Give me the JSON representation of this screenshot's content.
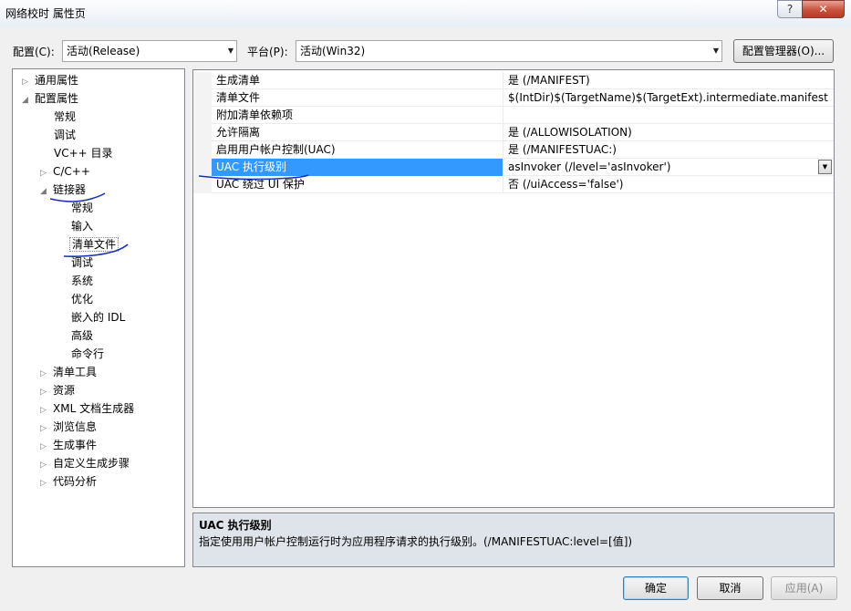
{
  "window": {
    "title": "网络校时 属性页",
    "help_label": "?",
    "close_label": "✕"
  },
  "config_bar": {
    "config_label": "配置(C):",
    "config_value": "活动(Release)",
    "platform_label": "平台(P):",
    "platform_value": "活动(Win32)",
    "manager_label": "配置管理器(O)..."
  },
  "tree": {
    "items": [
      {
        "label": "通用属性",
        "expander": "▷"
      },
      {
        "label": "配置属性",
        "expander": "◢"
      },
      {
        "label": "常规",
        "expander": ""
      },
      {
        "label": "调试",
        "expander": ""
      },
      {
        "label": "VC++ 目录",
        "expander": ""
      },
      {
        "label": "C/C++",
        "expander": "▷"
      },
      {
        "label": "链接器",
        "expander": "◢"
      },
      {
        "label": "常规",
        "expander": ""
      },
      {
        "label": "输入",
        "expander": ""
      },
      {
        "label": "清单文件",
        "expander": ""
      },
      {
        "label": "调试",
        "expander": ""
      },
      {
        "label": "系统",
        "expander": ""
      },
      {
        "label": "优化",
        "expander": ""
      },
      {
        "label": "嵌入的 IDL",
        "expander": ""
      },
      {
        "label": "高级",
        "expander": ""
      },
      {
        "label": "命令行",
        "expander": ""
      },
      {
        "label": "清单工具",
        "expander": "▷"
      },
      {
        "label": "资源",
        "expander": "▷"
      },
      {
        "label": "XML 文档生成器",
        "expander": "▷"
      },
      {
        "label": "浏览信息",
        "expander": "▷"
      },
      {
        "label": "生成事件",
        "expander": "▷"
      },
      {
        "label": "自定义生成步骤",
        "expander": "▷"
      },
      {
        "label": "代码分析",
        "expander": "▷"
      }
    ]
  },
  "properties": {
    "rows": [
      {
        "name": "生成清单",
        "value": "是 (/MANIFEST)"
      },
      {
        "name": "清单文件",
        "value": "$(IntDir)$(TargetName)$(TargetExt).intermediate.manifest"
      },
      {
        "name": "附加清单依赖项",
        "value": ""
      },
      {
        "name": "允许隔离",
        "value": "是 (/ALLOWISOLATION)"
      },
      {
        "name": "启用用户帐户控制(UAC)",
        "value": "是 (/MANIFESTUAC:)"
      },
      {
        "name": "UAC 执行级别",
        "value": "asInvoker (/level='asInvoker')"
      },
      {
        "name": "UAC 绕过 UI 保护",
        "value": "否 (/uiAccess='false')"
      }
    ],
    "dropdown_arrow": "▼"
  },
  "description": {
    "title": "UAC 执行级别",
    "text": "指定使用用户帐户控制运行时为应用程序请求的执行级别。(/MANIFESTUAC:level=[值])"
  },
  "footer": {
    "ok_label": "确定",
    "cancel_label": "取消",
    "apply_label": "应用(A)"
  },
  "colors": {
    "selection": "#3399ff",
    "annotation_ink": "#1a2fb8",
    "description_bg": "#dfe3ea"
  }
}
